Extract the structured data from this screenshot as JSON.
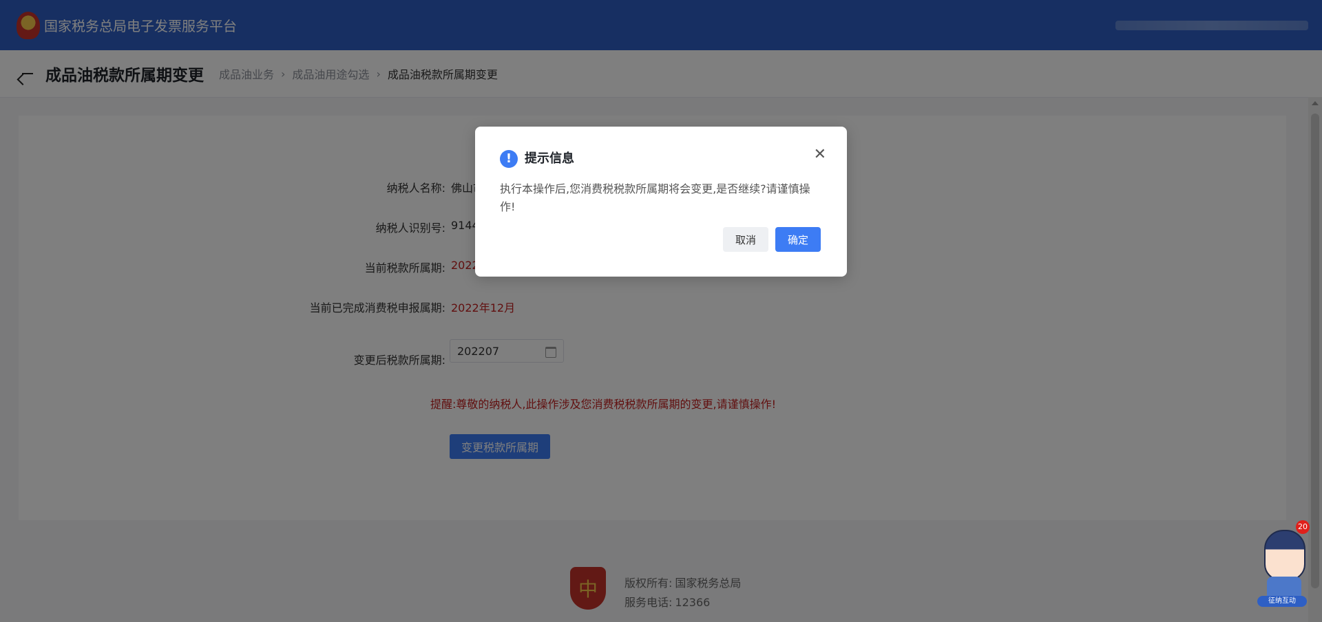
{
  "header": {
    "app_title": "国家税务总局电子发票服务平台"
  },
  "titlebar": {
    "title": "成品油税款所属期变更",
    "breadcrumbs": [
      "成品油业务",
      "成品油用途勾选",
      "成品油税款所属期变更"
    ]
  },
  "form": {
    "taxpayer_name_label": "纳税人名称:",
    "taxpayer_name_value": "佛山市",
    "taxpayer_id_label": "纳税人识别号:",
    "taxpayer_id_value": "9144",
    "current_period_label": "当前税款所属期:",
    "current_period_value": "2022",
    "completed_period_label": "当前已完成消费税申报属期:",
    "completed_period_value": "2022年12月",
    "new_period_label": "变更后税款所属期:",
    "new_period_value": "202207",
    "reminder_label": "提醒:",
    "reminder_text": "尊敬的纳税人,此操作涉及您消费税税款所属期的变更,请谨慎操作!",
    "submit_label": "变更税款所属期"
  },
  "footer": {
    "copyright_label": "版权所有:",
    "copyright_value": "国家税务总局",
    "phone_label": "服务电话:",
    "phone_value": "12366"
  },
  "dialog": {
    "title": "提示信息",
    "message": "执行本操作后,您消费税税款所属期将会变更,是否继续?请谨慎操作!",
    "cancel_label": "取消",
    "ok_label": "确定"
  },
  "assistant": {
    "label": "征纳互动",
    "badge": "20"
  },
  "colors": {
    "header": "#2e5fc4",
    "primary": "#3d7cf4",
    "warning": "#c21f1f"
  }
}
